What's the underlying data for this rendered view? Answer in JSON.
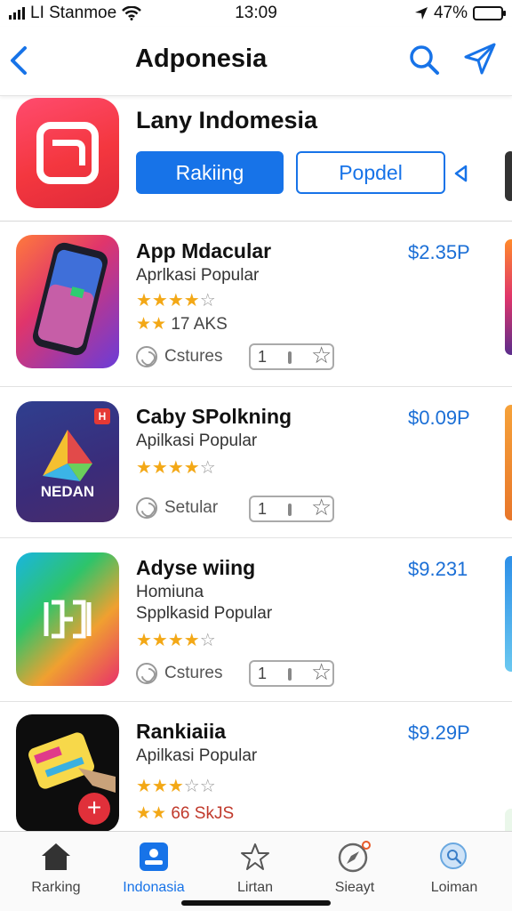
{
  "status_bar": {
    "carrier": "LI Stanmoe",
    "time": "13:09",
    "battery": "47%",
    "battery_level": 0.47
  },
  "nav": {
    "title": "Adponesia",
    "back_icon": "chevron-left-icon",
    "search_icon": "search-icon",
    "share_icon": "send-icon"
  },
  "featured": {
    "title": "Lany Indomesia",
    "primary_button": "Rakiing",
    "secondary_button": "Popdel",
    "icon": "app-icon-red",
    "accent": "#1773e8"
  },
  "apps": [
    {
      "name": "App Mdacular",
      "subtitle": "Aprlkasi Popular",
      "subtitle2": "",
      "price": "$2.35P",
      "rating": 4,
      "rating_count_stars": 2,
      "rating_count": "17 AKS",
      "chip": "Cstures",
      "stepper_value": "1"
    },
    {
      "name": "Caby SPolkning",
      "subtitle": "Apilkasi Popular",
      "subtitle2": "",
      "price": "$0.09P",
      "rating": 4,
      "rating_count_stars": 0,
      "rating_count": "",
      "chip": "Setular",
      "stepper_value": "1",
      "icon_text": "NEDAN",
      "badge": "H"
    },
    {
      "name": "Adyse wiing",
      "subtitle": "Homiuna",
      "subtitle2": "Spplkasid Popular",
      "price": "$9.231",
      "rating": 4,
      "rating_count_stars": 0,
      "rating_count": "",
      "chip": "Cstures",
      "stepper_value": "1"
    },
    {
      "name": "Rankiaiia",
      "subtitle": "Apilkasi Popular",
      "subtitle2": "",
      "price": "$9.29P",
      "rating": 3,
      "rating_count_stars": 2,
      "rating_count": "66 SkJS",
      "chip": "",
      "stepper_value": ""
    }
  ],
  "tabs": [
    {
      "label": "Rarking",
      "icon": "home-icon",
      "active": false
    },
    {
      "label": "Indonasia",
      "icon": "person-card-icon",
      "active": true
    },
    {
      "label": "Lirtan",
      "icon": "star-icon",
      "active": false
    },
    {
      "label": "Sieayt",
      "icon": "compass-icon",
      "active": false
    },
    {
      "label": "Loiman",
      "icon": "search-circle-icon",
      "active": false
    }
  ]
}
